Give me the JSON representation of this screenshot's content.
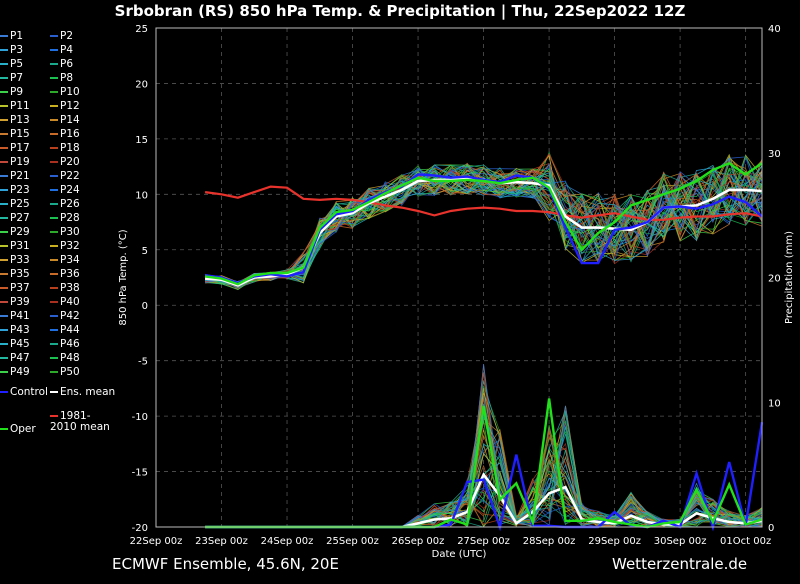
{
  "title": "Srbobran  (RS)  850 hPa Temp. & Precipitation | Thu, 22Sep2022 12Z",
  "footer": {
    "model": "ECMWF Ensemble, 45.6N, 20E",
    "site": "Wetterzentrale.de"
  },
  "legend": {
    "members": [
      "P1",
      "P2",
      "P3",
      "P4",
      "P5",
      "P6",
      "P7",
      "P8",
      "P9",
      "P10",
      "P11",
      "P12",
      "P13",
      "P14",
      "P15",
      "P16",
      "P17",
      "P18",
      "P19",
      "P20",
      "P21",
      "P22",
      "P23",
      "P24",
      "P25",
      "P26",
      "P27",
      "P28",
      "P29",
      "P30",
      "P31",
      "P32",
      "P33",
      "P34",
      "P35",
      "P36",
      "P37",
      "P38",
      "P39",
      "P40",
      "P41",
      "P42",
      "P43",
      "P44",
      "P45",
      "P46",
      "P47",
      "P48",
      "P49",
      "P50"
    ],
    "control": "Control",
    "ens_mean": "Ens. mean",
    "clim": "1981-2010 mean",
    "oper": "Oper"
  },
  "colors": {
    "control": "#1f1fff",
    "ens_mean": "#ffffff",
    "clim": "#e8332c",
    "oper": "#22e01c",
    "members": [
      "#3a7bd5",
      "#2a5fcf",
      "#2fa3d8",
      "#1f6fe0",
      "#27b0c8",
      "#1aa88a",
      "#22b8a0",
      "#1ac050",
      "#3ccf4a",
      "#2da82a",
      "#b8c22a",
      "#c8b020",
      "#d0a030",
      "#c88a28",
      "#c87a30",
      "#c86a28",
      "#c85a2a",
      "#b8401c",
      "#c0483a",
      "#a83020"
    ]
  },
  "chart_data": {
    "type": "line",
    "title": "Srbobran  (RS)  850 hPa Temp. & Precipitation | Thu, 22Sep2022 12Z",
    "xlabel": "Date (UTC)",
    "ylabel": "850 hPa Temp. (°C)",
    "y2label": "Precipitation (mm)",
    "x_ticks": [
      "22Sep 00z",
      "23Sep 00z",
      "24Sep 00z",
      "25Sep 00z",
      "26Sep 00z",
      "27Sep 00z",
      "28Sep 00z",
      "29Sep 00z",
      "30Sep 00z",
      "01Oct 00z"
    ],
    "x_tick_hours": [
      0,
      24,
      48,
      72,
      96,
      120,
      144,
      168,
      192,
      216
    ],
    "xlim": [
      0,
      222
    ],
    "ylim": [
      -20,
      25
    ],
    "y_ticks": [
      -20,
      -15,
      -10,
      -5,
      0,
      5,
      10,
      15,
      20,
      25
    ],
    "y2lim": [
      0,
      40
    ],
    "y2_ticks": [
      0,
      10,
      20,
      30,
      40
    ],
    "grid": true,
    "legend_position": "left",
    "hours": [
      18,
      24,
      30,
      36,
      42,
      48,
      54,
      60,
      66,
      72,
      78,
      84,
      90,
      96,
      102,
      108,
      114,
      120,
      126,
      132,
      138,
      144,
      150,
      156,
      162,
      168,
      174,
      180,
      186,
      192,
      198,
      204,
      210,
      216,
      222
    ],
    "series": [
      {
        "name": "1981-2010 mean",
        "values": [
          10.2,
          10.0,
          9.7,
          10.2,
          10.7,
          10.6,
          9.6,
          9.5,
          9.6,
          9.5,
          9.3,
          9.0,
          8.8,
          8.5,
          8.1,
          8.5,
          8.7,
          8.8,
          8.7,
          8.5,
          8.5,
          8.4,
          8.1,
          7.9,
          8.1,
          8.3,
          8.0,
          7.7,
          7.7,
          7.9,
          8.0,
          8.0,
          8.2,
          8.3,
          8.0
        ]
      },
      {
        "name": "Ens. mean",
        "values": [
          2.4,
          2.3,
          1.8,
          2.5,
          2.6,
          2.8,
          3.4,
          6.5,
          8.0,
          8.3,
          9.2,
          9.8,
          10.4,
          11.2,
          11.3,
          11.3,
          11.4,
          11.3,
          11.0,
          11.1,
          11.0,
          10.8,
          8.0,
          7.0,
          7.0,
          6.9,
          6.8,
          7.5,
          8.8,
          8.9,
          9.0,
          9.6,
          10.4,
          10.4,
          10.3
        ]
      },
      {
        "name": "Control",
        "values": [
          2.7,
          2.5,
          2.0,
          2.6,
          2.8,
          2.6,
          3.0,
          6.8,
          8.2,
          8.5,
          9.5,
          10.2,
          10.7,
          11.8,
          11.7,
          11.5,
          11.6,
          11.3,
          11.1,
          11.7,
          11.5,
          10.5,
          7.0,
          3.8,
          3.8,
          6.8,
          7.0,
          7.5,
          8.8,
          8.9,
          8.7,
          9.1,
          9.8,
          9.3,
          8.0
        ]
      },
      {
        "name": "Oper",
        "values": [
          2.6,
          2.4,
          1.9,
          2.7,
          2.9,
          2.9,
          3.4,
          7.0,
          8.4,
          8.6,
          9.3,
          10.1,
          10.8,
          11.5,
          11.2,
          11.2,
          11.3,
          11.2,
          11.0,
          11.3,
          11.5,
          10.6,
          7.5,
          5.0,
          6.5,
          7.5,
          9.0,
          9.5,
          10.0,
          10.5,
          11.2,
          12.2,
          12.8,
          11.8,
          12.8
        ]
      }
    ],
    "precip_series": [
      {
        "name": "Ens. mean",
        "values": [
          0,
          0,
          0,
          0,
          0,
          0,
          0,
          0,
          0,
          0,
          0,
          0,
          0,
          0.3,
          0.6,
          0.7,
          1.2,
          4.2,
          2.5,
          0.3,
          1.2,
          2.7,
          3.2,
          0.6,
          0.4,
          0.3,
          0.9,
          0.4,
          0.2,
          0.2,
          1.1,
          0.7,
          0.4,
          0.3,
          0.5
        ]
      },
      {
        "name": "Control",
        "values": [
          0,
          0,
          0,
          0,
          0,
          0,
          0,
          0,
          0,
          0,
          0,
          0,
          0,
          0,
          0,
          0.2,
          3.6,
          3.8,
          0,
          5.8,
          0.1,
          0.1,
          0,
          0,
          0,
          1.2,
          0.1,
          0,
          0.5,
          0,
          4.3,
          0,
          5.2,
          0.1,
          8.4
        ]
      },
      {
        "name": "Oper",
        "values": [
          0,
          0,
          0,
          0,
          0,
          0,
          0,
          0,
          0,
          0,
          0,
          0,
          0,
          0,
          0,
          0.6,
          0.2,
          9.7,
          2.2,
          3.5,
          0.4,
          10.3,
          0.5,
          0.5,
          0.7,
          0.4,
          0.2,
          0,
          0.3,
          0.4,
          3.0,
          0.4,
          3.4,
          0.2,
          0.6
        ]
      }
    ]
  }
}
